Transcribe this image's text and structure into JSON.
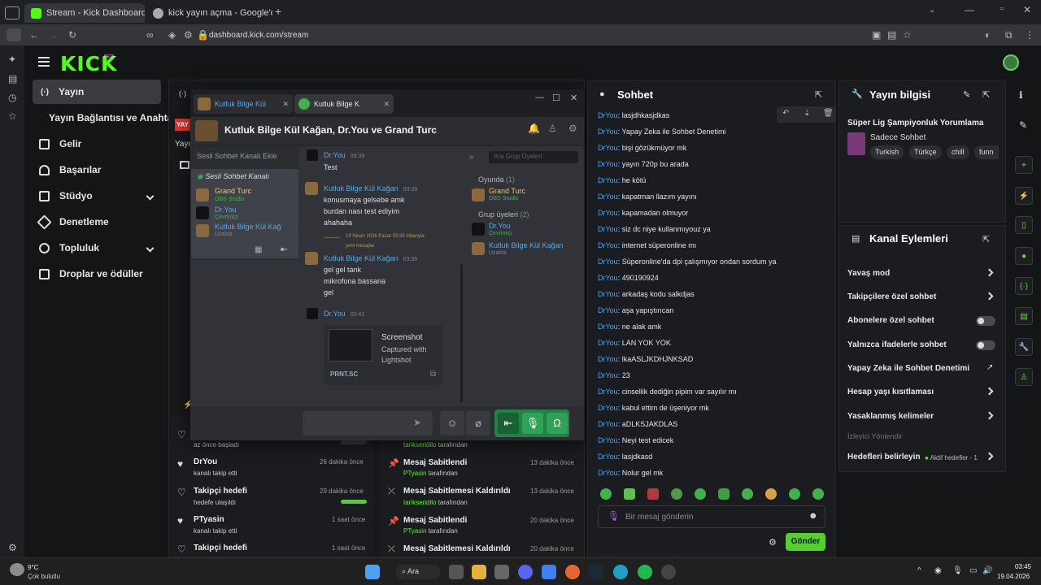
{
  "browser": {
    "tabs": [
      {
        "title": "Stream - Kick Dashboard"
      },
      {
        "title": "kick yayın açma - Google'da Ara"
      }
    ],
    "url": "dashboard.kick.com/stream"
  },
  "brand": {
    "logo": "KICK",
    "badge": "BETA"
  },
  "sidebar": {
    "items": [
      {
        "label": "Yayın"
      },
      {
        "label": "Yayın Bağlantısı ve Anahtarı"
      },
      {
        "label": "Gelir"
      },
      {
        "label": "Başarılar"
      },
      {
        "label": "Stüdyo"
      },
      {
        "label": "Denetleme"
      },
      {
        "label": "Topluluk"
      },
      {
        "label": "Droplar ve ödüller"
      }
    ]
  },
  "stream_partial": {
    "badge": "YAY",
    "label": "Yayı"
  },
  "chat": {
    "title": "Sohbet",
    "messages": [
      {
        "user": "DrYou",
        "text": "lasjdhkasjdkas"
      },
      {
        "user": "DrYou",
        "text": "Yapay Zeka ile Sohbet Denetimi"
      },
      {
        "user": "DrYou",
        "text": "bişi gözükmüyor mk"
      },
      {
        "user": "DrYou",
        "text": "yayın 720p bu arada"
      },
      {
        "user": "DrYou",
        "text": "he kötü"
      },
      {
        "user": "DrYou",
        "text": "kapatman llazım yayını"
      },
      {
        "user": "DrYou",
        "text": "kapamadan olmuyor"
      },
      {
        "user": "DrYou",
        "text": "siz dc niye kullanmıyouz ya"
      },
      {
        "user": "DrYou",
        "text": "internet süperonline mı"
      },
      {
        "user": "DrYou",
        "text": "Süperonline'da dpi çalışmıyor ondan sordum ya"
      },
      {
        "user": "DrYou",
        "text": "490190924"
      },
      {
        "user": "DrYou",
        "text": "arkadaş kodu salkdjas"
      },
      {
        "user": "DrYou",
        "text": "aşa yapıştırıcan"
      },
      {
        "user": "DrYou",
        "text": "ne alak amk"
      },
      {
        "user": "DrYou",
        "text": "LAN YOK YOK"
      },
      {
        "user": "DrYou",
        "text": "lkaASLJKDHJNKSAD"
      },
      {
        "user": "DrYou",
        "text": "23"
      },
      {
        "user": "DrYou",
        "text": "cinsellik dediğin pipim var sayılır mı"
      },
      {
        "user": "DrYou",
        "text": "kabul ettim de üşeniyor mk"
      },
      {
        "user": "DrYou",
        "text": "aDLKSJAKDLAS"
      },
      {
        "user": "DrYou",
        "text": "Neyi test edicek"
      },
      {
        "user": "DrYou",
        "text": "lasjdkasd"
      },
      {
        "user": "DrYou",
        "text": "Nolur gel mk"
      }
    ],
    "input_placeholder": "Bir mesaj gönderin",
    "send_label": "Gönder"
  },
  "stream_info": {
    "title": "Yayın bilgisi",
    "stream_title": "Süper Lig Şampiyonluk Yorumlama",
    "category": "Sadece Sohbet",
    "tags": [
      "Turkish",
      "Türkçe",
      "chill",
      "funn"
    ]
  },
  "channel_actions": {
    "title": "Kanal Eylemleri",
    "items": [
      {
        "label": "Yavaş mod",
        "control": "chevron"
      },
      {
        "label": "Takipçilere özel sohbet",
        "control": "chevron"
      },
      {
        "label": "Abonelere özel sohbet",
        "control": "toggle"
      },
      {
        "label": "Yalnızca ifadelerle sohbet",
        "control": "toggle"
      },
      {
        "label": "Yapay Zeka ile Sohbet Denetimi",
        "control": "external"
      },
      {
        "label": "Hesap yaşı kısıtlaması",
        "control": "chevron"
      },
      {
        "label": "Yasaklanmış kelimeler",
        "control": "chevron"
      }
    ],
    "section_label": "İzleyici Yönlendir",
    "goals_label": "Hedefleri belirleyin",
    "goals_status": "Aktif hedefler - 1"
  },
  "activity": {
    "left_partial": "az önce başladı",
    "left": [
      {
        "title": "DrYou",
        "sub": "kanalı takip etti",
        "time": "26 dakika önce"
      },
      {
        "title": "Takipçi hedefi",
        "sub": "hedefe ulaşıldı",
        "time": "29 dakika önce"
      },
      {
        "title": "PTyasin",
        "sub": "kanalı takip etti",
        "time": "1 saat önce"
      },
      {
        "title": "Takipçi hedefi",
        "sub": "",
        "time": "1 saat önce"
      }
    ],
    "right_partial": {
      "user": "tarikseridilo",
      "suffix": "tarafından"
    },
    "right": [
      {
        "title": "Mesaj Sabitlendi",
        "user": "PTyasin",
        "suffix": "tarafından",
        "time": "13 dakika önce"
      },
      {
        "title": "Mesaj Sabitlemesi Kaldırıldı",
        "user": "tarikseridilo",
        "suffix": "tarafından",
        "time": "13 dakika önce"
      },
      {
        "title": "Mesaj Sabitlendi",
        "user": "PTyasin",
        "suffix": "tarafından",
        "time": "20 dakika önce"
      },
      {
        "title": "Mesaj Sabitlemesi Kaldırıldı",
        "user": "",
        "suffix": "",
        "time": "20 dakika önce"
      }
    ]
  },
  "discord": {
    "tabs": [
      "Kutluk Bilge Kül",
      "Kutluk Bilge K"
    ],
    "header": "Kutluk Bilge Kül Kağan, Dr.You ve Grand Turc",
    "voice_add": "Sesli Sohbet Kanalı Ekle",
    "voice_channel": "Sesli Sohbet Kanalı",
    "voice_members": [
      {
        "name": "Grand Turc",
        "status": "OBS Studio"
      },
      {
        "name": "Dr.You",
        "status": "Çevrimiçi"
      },
      {
        "name": "Kutluk Bilge Kül Kağ",
        "status": "Uzakta"
      }
    ],
    "messages": [
      {
        "author": "Dr.You",
        "time": "03:39",
        "lines": [
          "Test"
        ]
      },
      {
        "author": "Kutluk Bilge Kül Kağan",
        "time": "03:39",
        "lines": [
          "konusmaya gelsebe amk",
          "burdan nası test ediyim",
          "ahahaha"
        ]
      },
      {
        "author": "Kutluk Bilge Kül Kağan",
        "time": "03:39",
        "lines": [
          "gel gel tank",
          "mikrofona bassana",
          "gel"
        ]
      },
      {
        "author": "Dr.You",
        "time": "03:41",
        "lines": []
      }
    ],
    "divider": "19 Nisan 2026 Pazar 03:39 itibarıyla",
    "divider2": "yeni mesajlar",
    "embed": {
      "title": "Screenshot",
      "desc1": "Captured with",
      "desc2": "Lightshot",
      "site": "PRNT.SC"
    },
    "search_placeholder": "Ara Grup Üyeleri",
    "groups": [
      {
        "label": "Oyunda",
        "count": "(1)"
      },
      {
        "label": "Grup üyeleri",
        "count": "(2)"
      }
    ],
    "members": [
      {
        "name": "Grand Turc",
        "status": "OBS Studio"
      },
      {
        "name": "Dr.You",
        "status": "Çevrimiçi"
      },
      {
        "name": "Kutluk Bilge Kül Kağan",
        "status": "Uzakta"
      }
    ]
  },
  "taskbar": {
    "weather": "9°C",
    "weather_desc": "Çok bulutlu",
    "search": "Ara",
    "time": "03:45",
    "date": "19.04.2026"
  },
  "colors": {
    "kick_green": "#53fc18",
    "user_blue": "#53a3e8",
    "send_button": "#53d12a"
  }
}
